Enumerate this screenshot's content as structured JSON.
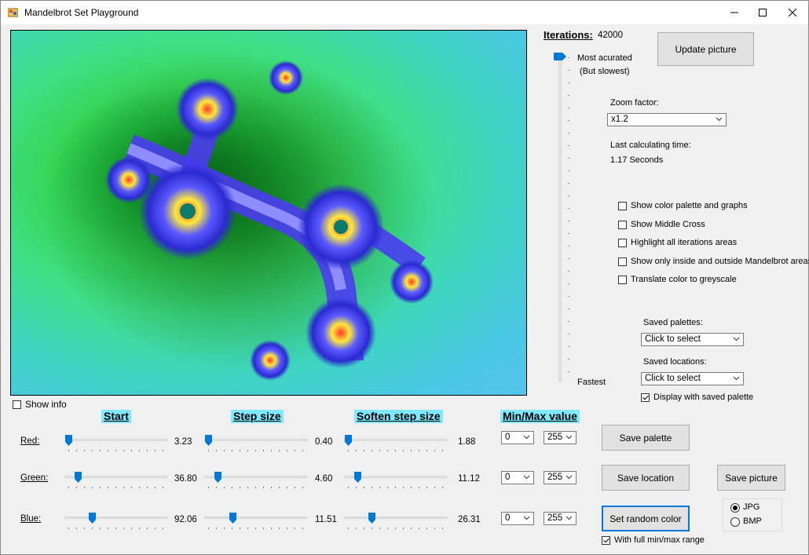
{
  "window": {
    "title": "Mandelbrot Set Playground"
  },
  "iterations": {
    "label": "Iterations:",
    "value": "42000",
    "top_label": "Most acurated",
    "top_sub": "(But slowest)",
    "bottom_label": "Fastest"
  },
  "update_button": "Update picture",
  "zoom": {
    "label": "Zoom factor:",
    "value": "x1.2"
  },
  "calc_time": {
    "label": "Last calculating time:",
    "value": "1.17 Seconds"
  },
  "options": [
    {
      "label": "Show color palette and graphs",
      "checked": false
    },
    {
      "label": "Show Middle Cross",
      "checked": false
    },
    {
      "label": "Highlight all iterations areas",
      "checked": false
    },
    {
      "label": "Show only inside and outside Mandelbrot areas",
      "checked": false
    },
    {
      "label": "Translate color to greyscale",
      "checked": false
    }
  ],
  "saved_palettes": {
    "label": "Saved palettes:",
    "value": "Click to select"
  },
  "saved_locations": {
    "label": "Saved locations:",
    "value": "Click to select"
  },
  "display_saved_palette": {
    "label": "Display with saved palette",
    "checked": true
  },
  "show_info": {
    "label": "Show info",
    "checked": false
  },
  "headers": {
    "start": "Start",
    "step": "Step size",
    "soften": "Soften step size",
    "minmax": "Min/Max value"
  },
  "rows": [
    {
      "label": "Red:",
      "start": "3.23",
      "step": "0.40",
      "soften": "1.88",
      "min": "0",
      "max": "255",
      "start_frac": 0.035,
      "step_frac": 0.035,
      "soften_frac": 0.035
    },
    {
      "label": "Green:",
      "start": "36.80",
      "step": "4.60",
      "soften": "11.12",
      "min": "0",
      "max": "255",
      "start_frac": 0.125,
      "step_frac": 0.125,
      "soften_frac": 0.125
    },
    {
      "label": "Blue:",
      "start": "92.06",
      "step": "11.51",
      "soften": "26.31",
      "min": "0",
      "max": "255",
      "start_frac": 0.27,
      "step_frac": 0.27,
      "soften_frac": 0.27
    }
  ],
  "buttons": {
    "save_palette": "Save  palette",
    "save_location": "Save location",
    "save_picture": "Save picture",
    "random_color": "Set random color"
  },
  "full_range": {
    "label": "With full min/max range",
    "checked": true
  },
  "format": {
    "options": [
      "JPG",
      "BMP"
    ],
    "selected": "JPG"
  },
  "colors": {
    "accent": "#0078d7",
    "header_bg": "#7fe8ff"
  }
}
